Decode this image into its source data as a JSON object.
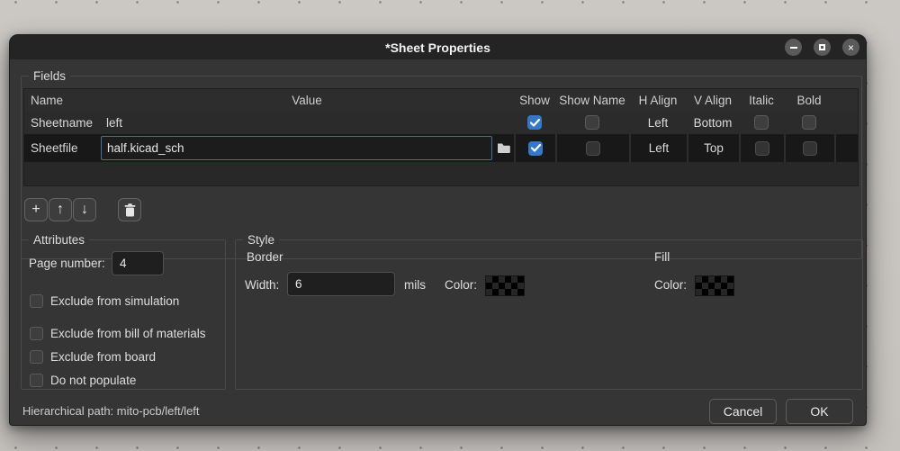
{
  "window": {
    "title": "*Sheet Properties",
    "close_glyph": "×"
  },
  "fields": {
    "group_label": "Fields",
    "columns": {
      "name": "Name",
      "value": "Value",
      "show": "Show",
      "show_name": "Show Name",
      "h_align": "H Align",
      "v_align": "V Align",
      "italic": "Italic",
      "bold": "Bold"
    },
    "rows": [
      {
        "name": "Sheetname",
        "value": "left",
        "show": true,
        "show_name": false,
        "h_align": "Left",
        "v_align": "Bottom",
        "italic": false,
        "bold": false
      },
      {
        "name": "Sheetfile",
        "value": "half.kicad_sch",
        "show": true,
        "show_name": false,
        "h_align": "Left",
        "v_align": "Top",
        "italic": false,
        "bold": false
      }
    ],
    "toolbar": {
      "add_glyph": "+",
      "up_glyph": "↑",
      "down_glyph": "↓"
    }
  },
  "attributes": {
    "group_label": "Attributes",
    "page_number_label": "Page number:",
    "page_number_value": "4",
    "checkboxes": [
      "Exclude from simulation",
      "Exclude from bill of materials",
      "Exclude from board",
      "Do not populate"
    ]
  },
  "style": {
    "group_label": "Style",
    "border_label": "Border",
    "width_label": "Width:",
    "width_value": "6",
    "width_unit": "mils",
    "border_color_label": "Color:",
    "fill_label": "Fill",
    "fill_color_label": "Color:"
  },
  "footer": {
    "hierarchical_path": "Hierarchical path:  mito-pcb/left/left",
    "cancel_label": "Cancel",
    "ok_label": "OK"
  },
  "colors": {
    "checkbox_accent": "#3578c6",
    "input_focus_border": "#44709d",
    "dialog_background": "#353535",
    "titlebar_background": "#242424"
  }
}
